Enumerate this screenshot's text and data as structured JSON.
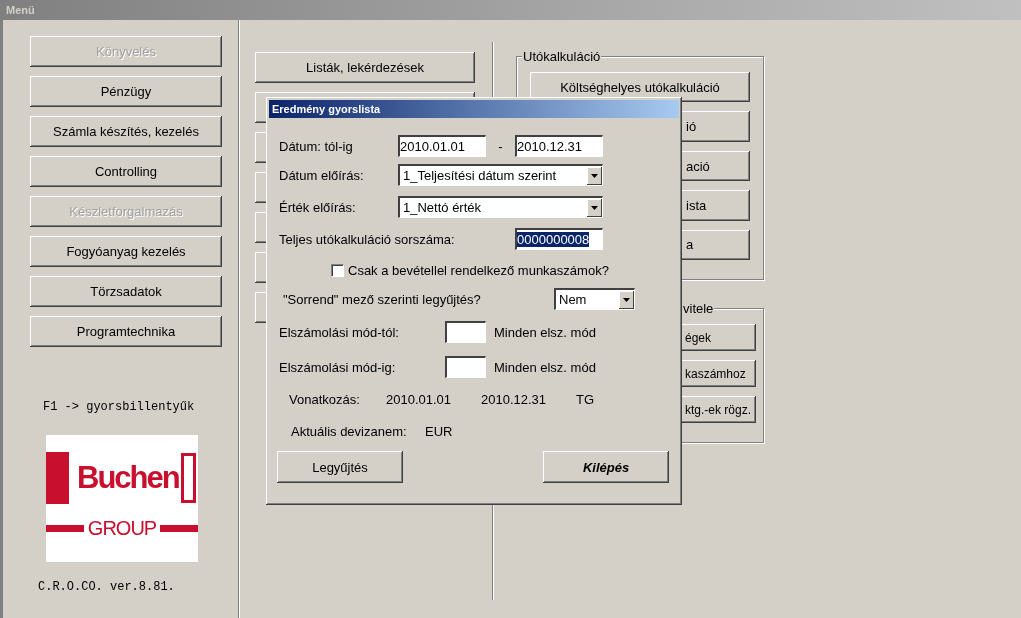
{
  "window": {
    "title": "Menü"
  },
  "main_menu": [
    {
      "label": "Könyvelés",
      "disabled": true
    },
    {
      "label": "Pénzügy",
      "disabled": false
    },
    {
      "label": "Számla készítés, kezelés",
      "disabled": false
    },
    {
      "label": "Controlling",
      "disabled": false
    },
    {
      "label": "Készletforgalmazás",
      "disabled": true
    },
    {
      "label": "Fogyóanyag kezelés",
      "disabled": false
    },
    {
      "label": "Törzsadatok",
      "disabled": false
    },
    {
      "label": "Programtechnika",
      "disabled": false
    }
  ],
  "hotkey_hint": "F1 -> gyorsbillentyűk",
  "logo": {
    "name": "Buchen",
    "sub": "GROUP"
  },
  "version": "C.R.O.CO. ver.8.81.",
  "middle_menu": [
    {
      "label": "Listák, lekérdezések"
    }
  ],
  "groups": [
    {
      "title": "Utókalkuláció",
      "kind": "full",
      "buttons": [
        {
          "label": "Költséghelyes utókalkuláció",
          "kind": "full"
        },
        {
          "label": "ió",
          "kind": "partial"
        },
        {
          "label": "ació",
          "kind": "partial"
        },
        {
          "label": "ista",
          "kind": "partial"
        },
        {
          "label": "a",
          "kind": "partial"
        }
      ]
    },
    {
      "title": "vitele",
      "kind": "partial",
      "buttons": [
        {
          "label": "égek",
          "kind": "partial"
        },
        {
          "label": "kaszámhoz",
          "kind": "partial"
        },
        {
          "label": "ktg.-ek rögz.",
          "kind": "partial"
        }
      ]
    }
  ],
  "dialog": {
    "title": "Eredmény gyorslista",
    "date_range": {
      "label": "Dátum: tól-ig",
      "from": "2010.01.01",
      "separator": "-",
      "to": "2010.12.31"
    },
    "date_rule": {
      "label": "Dátum előírás:",
      "value": "1_Teljesítési dátum szerint"
    },
    "value_rule": {
      "label": "Érték előírás:",
      "value": "1_Nettó érték"
    },
    "calc_number": {
      "label": "Teljes utókalkuláció sorszáma:",
      "value": "0000000008",
      "selected": true
    },
    "revenue_only": {
      "label": "Csak a bevétellel rendelkező munkaszámok?",
      "checked": false
    },
    "order_by": {
      "label": "\"Sorrend\" mező szerinti legyűjtés?",
      "value": "Nem"
    },
    "mode_from": {
      "label": "Elszámolási mód-tól:",
      "hint": "Minden elsz. mód"
    },
    "mode_to": {
      "label": "Elszámolási mód-ig:",
      "hint": "Minden elsz. mód"
    },
    "reference": {
      "label": "Vonatkozás:",
      "from": "2010.01.01",
      "to": "2010.12.31",
      "type": "TG"
    },
    "currency": {
      "label": "Aktuális devizanem:",
      "value": "EUR"
    },
    "buttons": [
      {
        "label": "Legyűjtés",
        "kind": "normal"
      },
      {
        "label": "Kilépés",
        "kind": "bold"
      }
    ]
  }
}
